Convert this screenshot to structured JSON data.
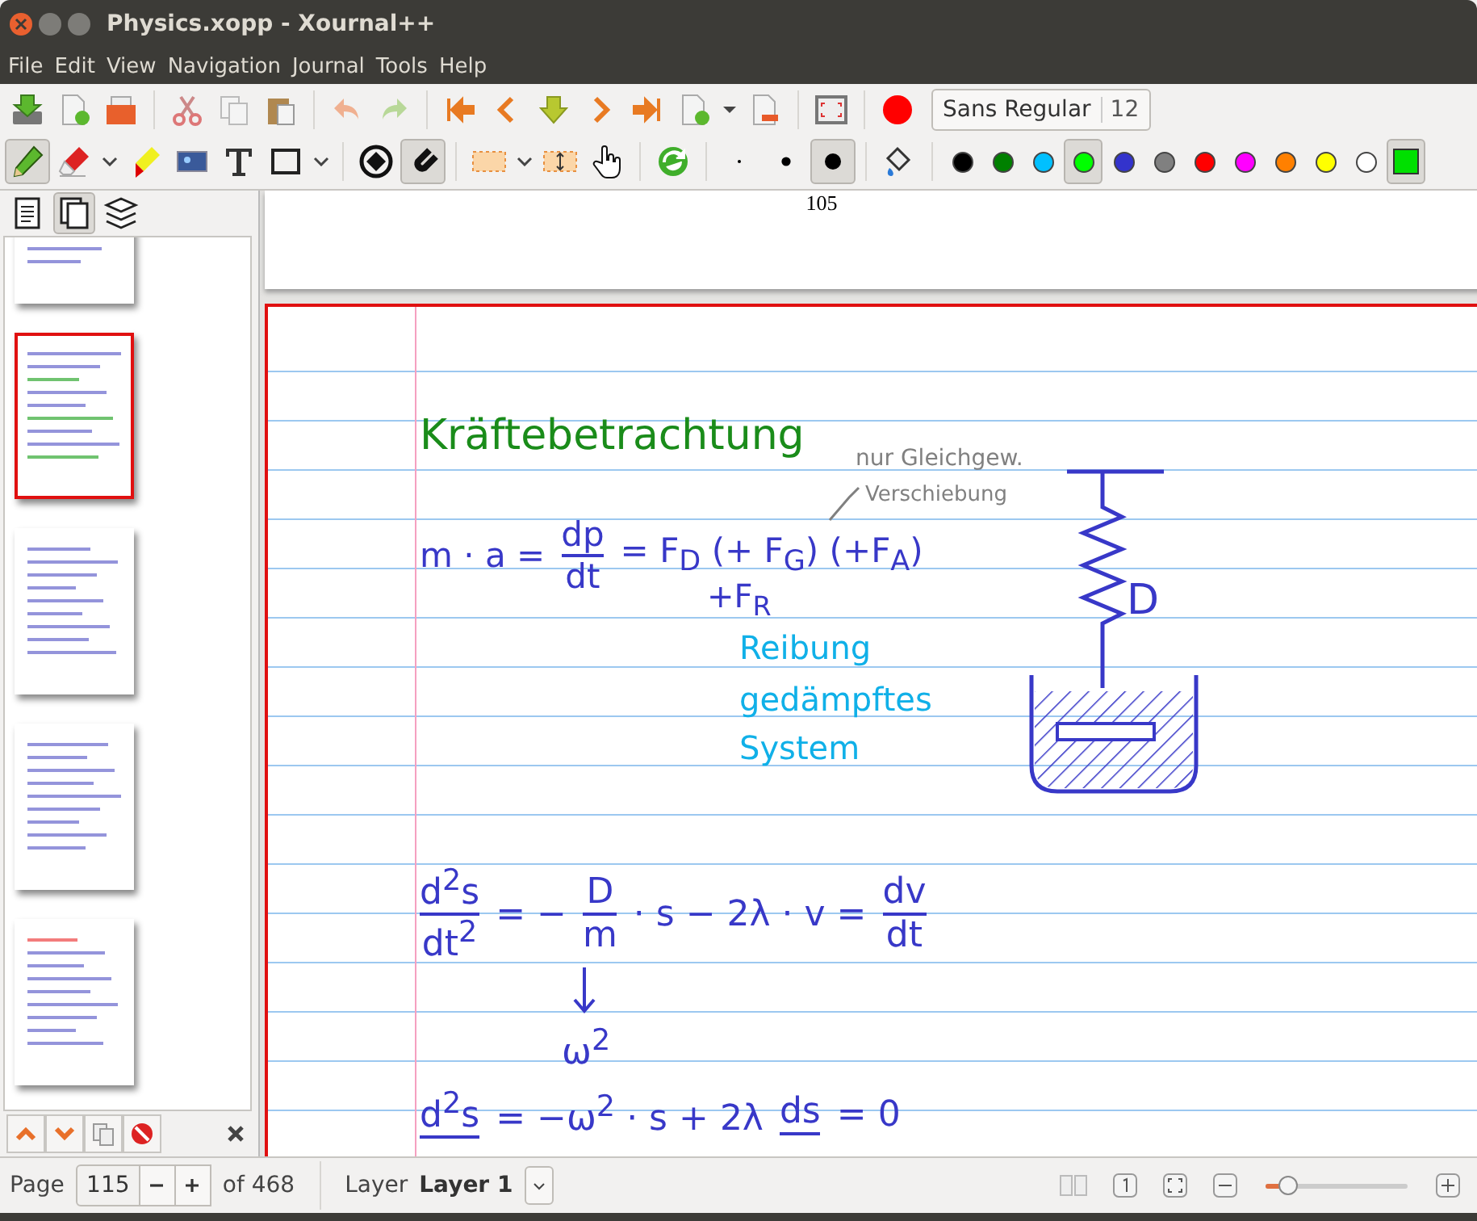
{
  "window": {
    "title": "Physics.xopp - Xournal++"
  },
  "menu": [
    "File",
    "Edit",
    "View",
    "Navigation",
    "Journal",
    "Tools",
    "Help"
  ],
  "toolbar": {
    "font": {
      "name": "Sans Regular",
      "size": "12"
    },
    "tools": [
      {
        "kind": "pen",
        "selected": true,
        "has_menu": false
      },
      {
        "kind": "eraser",
        "selected": false,
        "has_menu": true
      },
      {
        "kind": "highlighter",
        "selected": false,
        "has_menu": false
      },
      {
        "kind": "image",
        "selected": false,
        "has_menu": false
      },
      {
        "kind": "text",
        "selected": false,
        "has_menu": false
      },
      {
        "kind": "shape",
        "selected": false,
        "has_menu": true
      }
    ],
    "snap": {
      "rotation": false,
      "grid": true
    },
    "selection_tools": [
      {
        "kind": "rect",
        "selected": false,
        "has_menu": true
      },
      {
        "kind": "vertical_space",
        "selected": false,
        "has_menu": false
      },
      {
        "kind": "hand",
        "selected": false,
        "has_menu": false
      }
    ],
    "sizes": [
      {
        "kind": "fine",
        "selected": false
      },
      {
        "kind": "medium",
        "selected": false
      },
      {
        "kind": "thick",
        "selected": true
      }
    ],
    "palette": [
      {
        "color": "#000000",
        "selected": false
      },
      {
        "color": "#008000",
        "selected": false
      },
      {
        "color": "#00c0ff",
        "selected": false
      },
      {
        "color": "#00ff00",
        "selected": true
      },
      {
        "color": "#3333cc",
        "selected": false
      },
      {
        "color": "#808080",
        "selected": false
      },
      {
        "color": "#ff0000",
        "selected": false
      },
      {
        "color": "#ff00ff",
        "selected": false
      },
      {
        "color": "#ff8000",
        "selected": false
      },
      {
        "color": "#ffff00",
        "selected": false
      },
      {
        "color": "#ffffff",
        "selected": false
      }
    ],
    "custom_color": {
      "color": "#00e000",
      "selected": true
    }
  },
  "sidebar": {
    "tabs": [
      {
        "kind": "outline",
        "selected": false
      },
      {
        "kind": "pages",
        "selected": true
      },
      {
        "kind": "layers",
        "selected": false
      }
    ],
    "thumbnails": [
      {
        "selected": false
      },
      {
        "selected": true
      },
      {
        "selected": false
      },
      {
        "selected": false
      },
      {
        "selected": false
      }
    ]
  },
  "document": {
    "previous_page": {
      "number": "105"
    },
    "ink": [
      {
        "kind": "text",
        "text": "Kräftebetrachtung",
        "color": "#1a8c1a"
      },
      {
        "kind": "text",
        "text": "nur Gleichgew.",
        "color": "#808080"
      },
      {
        "kind": "text",
        "text": "Verschiebung",
        "color": "#808080"
      },
      {
        "kind": "equation",
        "color": "#3838c8",
        "parts": [
          {
            "kind": "t",
            "text": "m · a ="
          },
          {
            "kind": "frac",
            "num": "dp",
            "den": "dt"
          },
          {
            "kind": "t",
            "text": "= F$_{D}$ (+ F$_{G}$) (+F$_{A}$)"
          }
        ]
      },
      {
        "kind": "text",
        "text": "+F$_{R}$",
        "color": "#3838c8"
      },
      {
        "kind": "text",
        "text": "Reibung",
        "color": "#10b0e8"
      },
      {
        "kind": "text",
        "text": "gedämpftes",
        "color": "#10b0e8"
      },
      {
        "kind": "text",
        "text": "System",
        "color": "#10b0e8"
      },
      {
        "kind": "text",
        "text": "D",
        "color": "#3838c8"
      },
      {
        "kind": "equation",
        "color": "#3838c8",
        "parts": [
          {
            "kind": "frac",
            "num": "d$^{2}$s",
            "den": "dt$^{2}$"
          },
          {
            "kind": "t",
            "text": "= −"
          },
          {
            "kind": "frac",
            "num": "D",
            "den": "m"
          },
          {
            "kind": "t",
            "text": "· s − 2λ · v ="
          },
          {
            "kind": "frac",
            "num": "dv",
            "den": "dt"
          }
        ]
      },
      {
        "kind": "text",
        "text": "ω$^{2}$",
        "color": "#3838c8"
      },
      {
        "kind": "equation",
        "color": "#3838c8",
        "parts": [
          {
            "kind": "frac",
            "num": "d$^{2}$s"
          },
          {
            "kind": "t",
            "text": "= −ω$^{2}$ · s + 2λ"
          },
          {
            "kind": "frac",
            "num": "ds"
          },
          {
            "kind": "t",
            "text": "= 0"
          }
        ]
      }
    ]
  },
  "status_bar": {
    "page_label": "Page",
    "page": "115",
    "total": "of 468",
    "layer_label": "Layer",
    "layer": "Layer 1",
    "zoom": {
      "level": 0.2
    }
  }
}
